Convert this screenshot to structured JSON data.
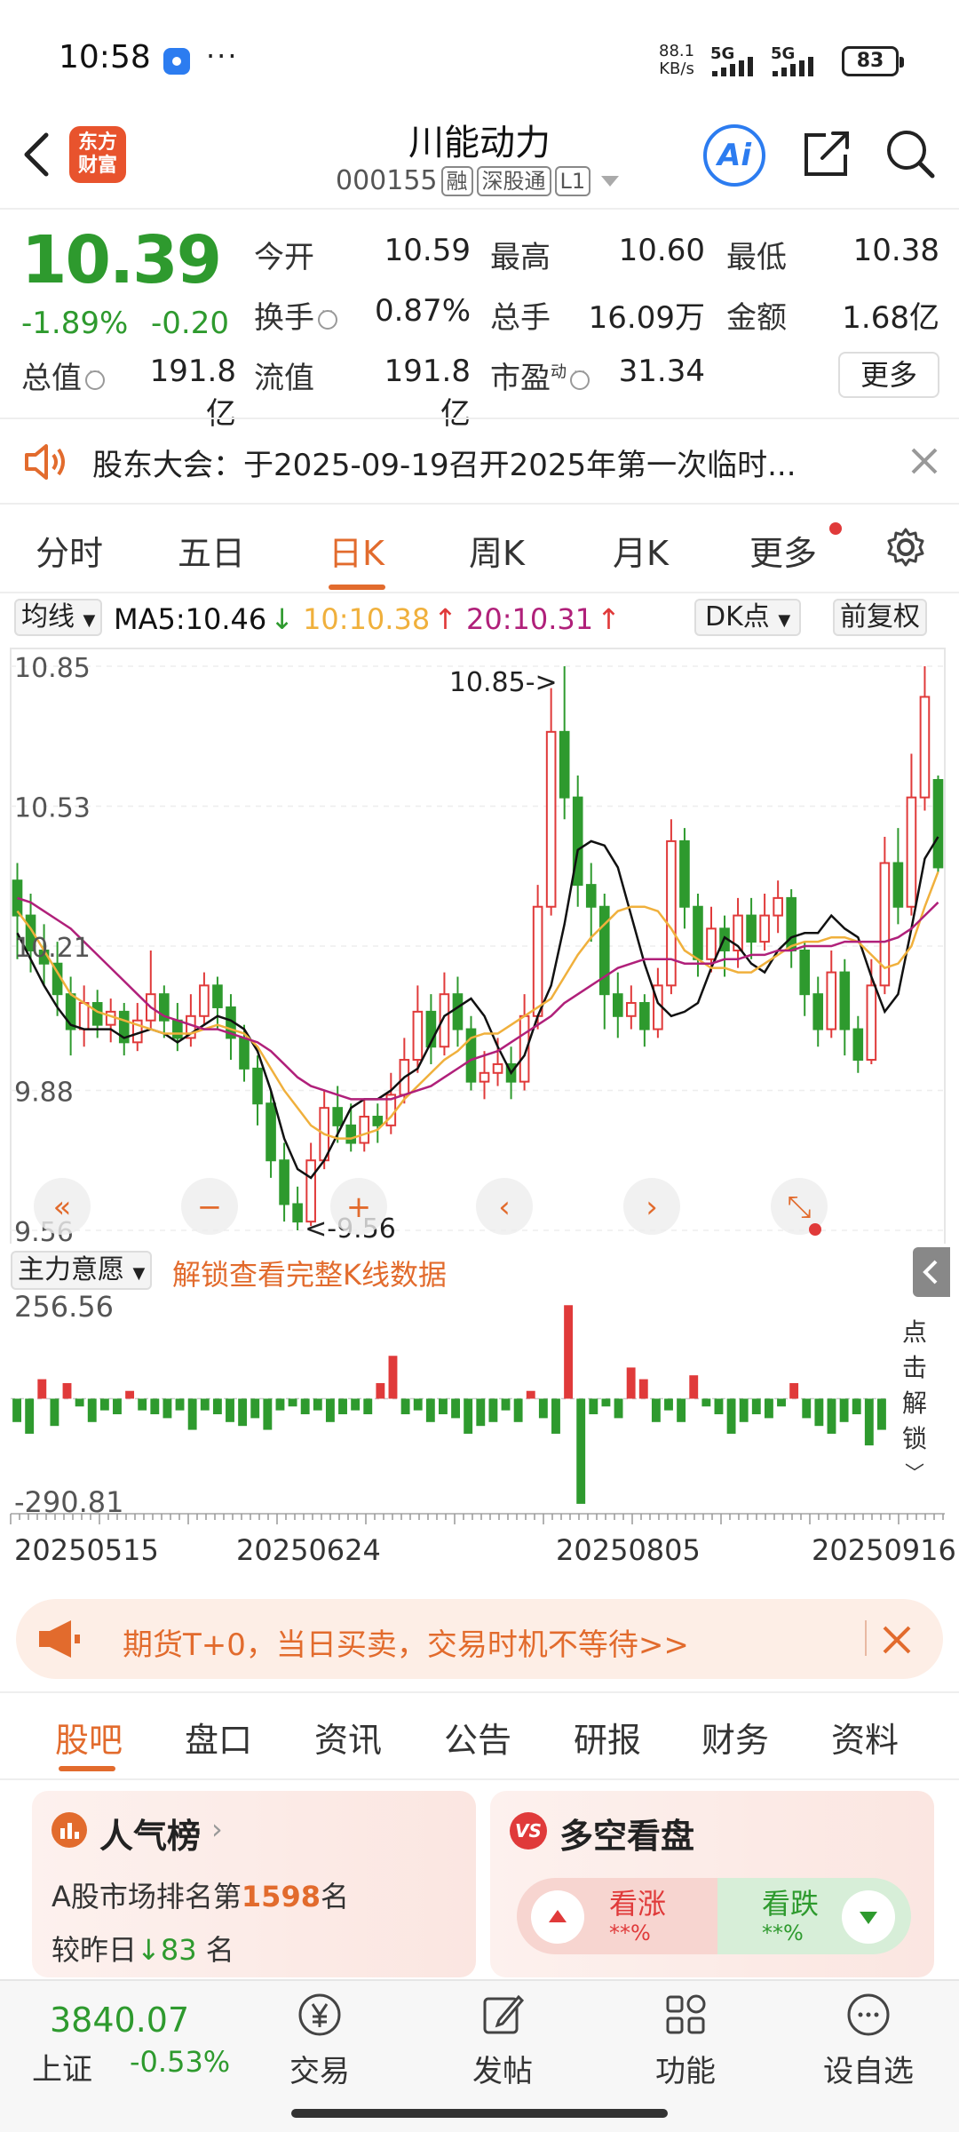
{
  "status_bar": {
    "time": "10:58",
    "more": "···",
    "net_speed_top": "88.1",
    "net_speed_bottom": "KB/s",
    "signal1": "5G",
    "signal2": "5G",
    "battery": "83"
  },
  "header": {
    "logo_top": "东方",
    "logo_bottom": "财富",
    "stock_name": "川能动力",
    "stock_code": "000155",
    "tags": [
      "融",
      "深股通",
      "L1"
    ],
    "ai_label": "Ai"
  },
  "quote": {
    "price": "10.39",
    "change_pct": "-1.89%",
    "change_amt": "-0.20",
    "open_label": "今开",
    "open": "10.59",
    "high_label": "最高",
    "high": "10.60",
    "low_label": "最低",
    "low": "10.38",
    "turnover_label": "换手",
    "turnover": "0.87%",
    "volume_label": "总手",
    "volume": "16.09万",
    "amount_label": "金额",
    "amount": "1.68亿",
    "mktcap_label": "总值",
    "mktcap": "191.8亿",
    "float_label": "流值",
    "float_cap": "191.8亿",
    "pe_label": "市盈",
    "pe_sup": "动",
    "pe": "31.34",
    "more_button": "更多"
  },
  "notice": {
    "text": "股东大会：于2025-09-19召开2025年第一次临时..."
  },
  "chart_tabs": {
    "items": [
      "分时",
      "五日",
      "日K",
      "周K",
      "月K",
      "更多"
    ],
    "active": "日K"
  },
  "ma_row": {
    "select_label": "均线",
    "ma5": "MA5:10.46",
    "ma5_arrow": "↓",
    "ma10": "10:10.38",
    "ma10_arrow": "↑",
    "ma20": "20:10.31",
    "ma20_arrow": "↑",
    "dk_label": "DK点",
    "fq_label": "前复权"
  },
  "colors": {
    "up": "#e03a3a",
    "down": "#2e9a2e",
    "ma5": "#111111",
    "ma10": "#f0b03c",
    "ma20": "#b0207a",
    "accent": "#e26b2d"
  },
  "chart_data": [
    {
      "type": "candlestick",
      "title": "日K",
      "y_ticks": [
        "10.85",
        "10.53",
        "10.21",
        "9.88",
        "9.56"
      ],
      "ylim": [
        9.56,
        10.85
      ],
      "max_marker": "10.85->",
      "min_marker": "<-9.56",
      "grid": true,
      "series": [
        {
          "name": "MA5",
          "values": [
            10.24,
            10.18,
            10.12,
            10.07,
            10.03,
            10.02,
            10.02,
            10.02,
            10.0,
            10.01,
            10.02,
            10.01,
            9.99,
            10.01,
            10.03,
            10.05,
            10.04,
            10.02,
            9.97,
            9.88,
            9.77,
            9.7,
            9.68,
            9.72,
            9.78,
            9.84,
            9.86,
            9.86,
            9.88,
            9.91,
            9.93,
            9.99,
            10.05,
            10.07,
            10.09,
            10.05,
            9.98,
            9.92,
            9.96,
            10.05,
            10.12,
            10.26,
            10.43,
            10.45,
            10.44,
            10.39,
            10.28,
            10.17,
            10.08,
            10.05,
            10.06,
            10.08,
            10.16,
            10.23,
            10.21,
            10.17,
            10.15,
            10.2,
            10.23,
            10.24,
            10.24,
            10.28,
            10.25,
            10.23,
            10.14,
            10.06,
            10.1,
            10.25,
            10.41,
            10.46
          ]
        },
        {
          "name": "MA10",
          "values": [
            10.29,
            10.25,
            10.2,
            10.15,
            10.1,
            10.08,
            10.06,
            10.05,
            10.04,
            10.03,
            10.02,
            10.01,
            10.01,
            10.01,
            10.02,
            10.03,
            10.02,
            10.01,
            9.98,
            9.93,
            9.88,
            9.84,
            9.8,
            9.78,
            9.77,
            9.77,
            9.78,
            9.79,
            9.82,
            9.86,
            9.89,
            9.92,
            9.95,
            9.97,
            10.0,
            10.01,
            10.01,
            10.03,
            10.05,
            10.07,
            10.09,
            10.14,
            10.19,
            10.23,
            10.26,
            10.29,
            10.3,
            10.3,
            10.29,
            10.25,
            10.2,
            10.18,
            10.16,
            10.16,
            10.15,
            10.15,
            10.17,
            10.19,
            10.21,
            10.22,
            10.22,
            10.23,
            10.23,
            10.22,
            10.19,
            10.16,
            10.17,
            10.21,
            10.3,
            10.38
          ]
        },
        {
          "name": "MA20",
          "values": [
            10.32,
            10.31,
            10.29,
            10.27,
            10.25,
            10.22,
            10.19,
            10.16,
            10.13,
            10.1,
            10.07,
            10.05,
            10.04,
            10.03,
            10.02,
            10.02,
            10.01,
            10.0,
            9.99,
            9.97,
            9.94,
            9.91,
            9.89,
            9.88,
            9.87,
            9.86,
            9.86,
            9.86,
            9.86,
            9.87,
            9.88,
            9.89,
            9.91,
            9.93,
            9.95,
            9.96,
            9.97,
            9.99,
            10.01,
            10.03,
            10.05,
            10.08,
            10.1,
            10.12,
            10.14,
            10.16,
            10.17,
            10.18,
            10.18,
            10.18,
            10.17,
            10.17,
            10.17,
            10.18,
            10.18,
            10.19,
            10.19,
            10.2,
            10.2,
            10.21,
            10.21,
            10.21,
            10.22,
            10.22,
            10.22,
            10.22,
            10.23,
            10.25,
            10.28,
            10.31
          ]
        }
      ],
      "candles": [
        [
          10.36,
          10.28,
          10.4,
          10.18
        ],
        [
          10.28,
          10.2,
          10.33,
          10.15
        ],
        [
          10.2,
          10.17,
          10.26,
          10.12
        ],
        [
          10.17,
          10.1,
          10.22,
          10.05
        ],
        [
          10.1,
          10.02,
          10.14,
          9.96
        ],
        [
          10.02,
          10.08,
          10.12,
          9.98
        ],
        [
          10.08,
          10.03,
          10.11,
          10.0
        ],
        [
          10.03,
          10.06,
          10.09,
          9.99
        ],
        [
          10.06,
          9.99,
          10.08,
          9.96
        ],
        [
          9.99,
          10.04,
          10.08,
          9.97
        ],
        [
          10.04,
          10.1,
          10.2,
          10.02
        ],
        [
          10.1,
          10.04,
          10.12,
          10.0
        ],
        [
          10.04,
          10.0,
          10.08,
          9.97
        ],
        [
          10.0,
          10.05,
          10.1,
          9.98
        ],
        [
          10.05,
          10.12,
          10.15,
          10.03
        ],
        [
          10.12,
          10.07,
          10.14,
          10.02
        ],
        [
          10.07,
          10.0,
          10.1,
          9.95
        ],
        [
          10.0,
          9.93,
          10.03,
          9.9
        ],
        [
          9.93,
          9.85,
          9.96,
          9.8
        ],
        [
          9.85,
          9.72,
          9.88,
          9.68
        ],
        [
          9.72,
          9.62,
          9.76,
          9.58
        ],
        [
          9.62,
          9.58,
          9.66,
          9.56
        ],
        [
          9.58,
          9.72,
          9.76,
          9.57
        ],
        [
          9.72,
          9.84,
          9.88,
          9.7
        ],
        [
          9.84,
          9.8,
          9.89,
          9.76
        ],
        [
          9.8,
          9.76,
          9.85,
          9.74
        ],
        [
          9.76,
          9.82,
          9.86,
          9.74
        ],
        [
          9.82,
          9.8,
          9.85,
          9.76
        ],
        [
          9.8,
          9.87,
          9.92,
          9.78
        ],
        [
          9.87,
          9.95,
          10.0,
          9.85
        ],
        [
          9.95,
          10.06,
          10.12,
          9.92
        ],
        [
          10.06,
          9.98,
          10.1,
          9.94
        ],
        [
          9.98,
          10.1,
          10.15,
          9.96
        ],
        [
          10.1,
          10.02,
          10.14,
          9.98
        ],
        [
          10.02,
          9.9,
          10.05,
          9.88
        ],
        [
          9.9,
          9.92,
          9.97,
          9.86
        ],
        [
          9.92,
          9.94,
          10.0,
          9.89
        ],
        [
          9.94,
          9.9,
          9.98,
          9.86
        ],
        [
          9.9,
          10.05,
          10.1,
          9.88
        ],
        [
          10.05,
          10.3,
          10.35,
          10.02
        ],
        [
          10.3,
          10.7,
          10.8,
          10.28
        ],
        [
          10.7,
          10.55,
          10.85,
          10.5
        ],
        [
          10.55,
          10.35,
          10.6,
          10.3
        ],
        [
          10.35,
          10.3,
          10.4,
          10.22
        ],
        [
          10.3,
          10.1,
          10.33,
          10.02
        ],
        [
          10.1,
          10.05,
          10.15,
          10.0
        ],
        [
          10.05,
          10.08,
          10.12,
          10.02
        ],
        [
          10.08,
          10.02,
          10.1,
          9.98
        ],
        [
          10.02,
          10.12,
          10.16,
          10.0
        ],
        [
          10.12,
          10.45,
          10.5,
          10.1
        ],
        [
          10.45,
          10.3,
          10.48,
          10.25
        ],
        [
          10.3,
          10.18,
          10.33,
          10.14
        ],
        [
          10.18,
          10.25,
          10.3,
          10.15
        ],
        [
          10.25,
          10.2,
          10.28,
          10.14
        ],
        [
          10.2,
          10.28,
          10.32,
          10.16
        ],
        [
          10.28,
          10.22,
          10.32,
          10.18
        ],
        [
          10.22,
          10.28,
          10.33,
          10.2
        ],
        [
          10.28,
          10.32,
          10.36,
          10.24
        ],
        [
          10.32,
          10.2,
          10.34,
          10.16
        ],
        [
          10.2,
          10.1,
          10.22,
          10.05
        ],
        [
          10.1,
          10.02,
          10.14,
          9.98
        ],
        [
          10.02,
          10.15,
          10.2,
          10.0
        ],
        [
          10.15,
          10.02,
          10.18,
          9.96
        ],
        [
          10.02,
          9.95,
          10.05,
          9.92
        ],
        [
          9.95,
          10.12,
          10.18,
          9.94
        ],
        [
          10.12,
          10.4,
          10.46,
          10.1
        ],
        [
          10.4,
          10.3,
          10.48,
          10.26
        ],
        [
          10.3,
          10.55,
          10.65,
          10.28
        ],
        [
          10.55,
          10.78,
          10.85,
          10.52
        ],
        [
          10.59,
          10.39,
          10.6,
          10.38
        ]
      ]
    },
    {
      "type": "bar",
      "title": "主力意愿",
      "y_ticks": [
        "256.56",
        "-290.81"
      ],
      "ylim": [
        -290.81,
        256.56
      ],
      "x_tick_labels": [
        "20250515",
        "20250624",
        "20250805",
        "20250916"
      ],
      "values": [
        -60,
        -90,
        50,
        -70,
        40,
        -20,
        -60,
        -30,
        -40,
        20,
        -30,
        -40,
        -50,
        -30,
        -80,
        -30,
        -40,
        -60,
        -70,
        -50,
        -80,
        -30,
        -20,
        -40,
        -30,
        -60,
        -40,
        -30,
        -40,
        40,
        110,
        -40,
        -30,
        -60,
        -40,
        -50,
        -90,
        -70,
        -60,
        -30,
        -60,
        20,
        -50,
        -90,
        240,
        -270,
        -40,
        -20,
        -50,
        80,
        50,
        -60,
        -30,
        -60,
        60,
        -20,
        -40,
        -90,
        -60,
        -40,
        -50,
        -20,
        40,
        -50,
        -70,
        -90,
        -60,
        -40,
        -120,
        -80
      ]
    }
  ],
  "indicator": {
    "select_label": "主力意愿",
    "unlock_link": "解锁查看完整K线数据",
    "unlock_side": [
      "点",
      "击",
      "解",
      "锁"
    ]
  },
  "promo": {
    "text": "期货T+0，当日买卖，交易时机不等待>>"
  },
  "bottom_tabs": {
    "items": [
      "股吧",
      "盘口",
      "资讯",
      "公告",
      "研报",
      "财务",
      "资料"
    ],
    "active": "股吧"
  },
  "popularity": {
    "title": "人气榜",
    "rank_prefix": "A股市场排名第",
    "rank": "1598",
    "rank_suffix": "名",
    "delta_prefix": "较昨日",
    "delta": "83",
    "delta_suffix": " 名"
  },
  "long_short": {
    "title": "多空看盘",
    "icon": "VS",
    "bull_label": "看涨",
    "bull_pct": "**%",
    "bear_label": "看跌",
    "bear_pct": "**%"
  },
  "bottom_nav": {
    "index_value": "3840.07",
    "index_name": "上证",
    "index_change": "-0.53%",
    "items": [
      {
        "label": "交易",
        "icon": "yen-coin-icon"
      },
      {
        "label": "发帖",
        "icon": "compose-icon"
      },
      {
        "label": "功能",
        "icon": "grid-icon"
      },
      {
        "label": "设自选",
        "icon": "chat-bubble-icon"
      }
    ]
  }
}
